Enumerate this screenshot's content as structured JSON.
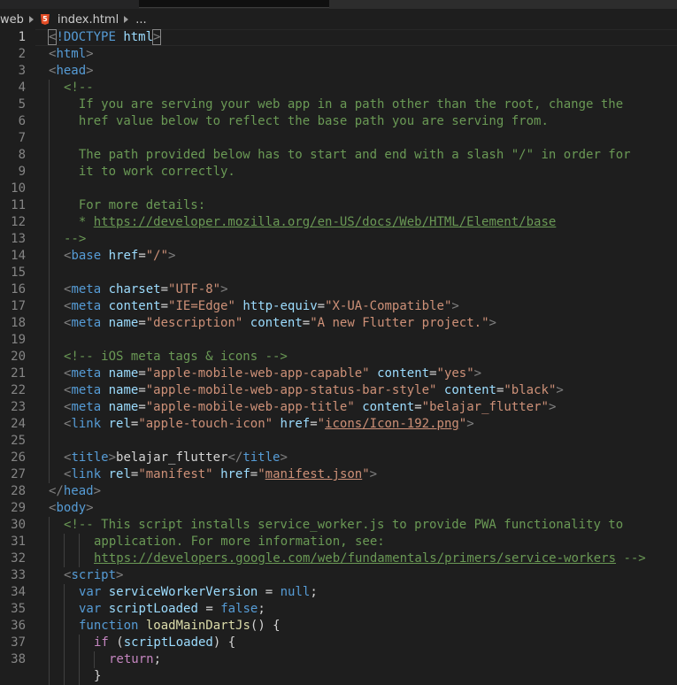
{
  "breadcrumb": {
    "folder": "web",
    "file": "index.html",
    "more": "..."
  },
  "editor": {
    "language": "html",
    "active_line": 1,
    "lines": [
      {
        "n": "1",
        "indent": 0,
        "tokens": [
          {
            "t": "<",
            "c": "punc"
          },
          {
            "t": "!DOCTYPE",
            "c": "tag"
          },
          {
            "t": " ",
            "c": "txt"
          },
          {
            "t": "html",
            "c": "attr"
          },
          {
            "t": ">",
            "c": "punc"
          }
        ]
      },
      {
        "n": "2",
        "indent": 0,
        "tokens": [
          {
            "t": "<",
            "c": "punc"
          },
          {
            "t": "html",
            "c": "tag"
          },
          {
            "t": ">",
            "c": "punc"
          }
        ]
      },
      {
        "n": "3",
        "indent": 0,
        "tokens": [
          {
            "t": "<",
            "c": "punc"
          },
          {
            "t": "head",
            "c": "tag"
          },
          {
            "t": ">",
            "c": "punc"
          }
        ]
      },
      {
        "n": "4",
        "indent": 1,
        "tokens": [
          {
            "t": "<!--",
            "c": "com"
          }
        ]
      },
      {
        "n": "5",
        "indent": 1,
        "tokens": [
          {
            "t": "  If you are serving your web app in a path other than the root, change the",
            "c": "com"
          }
        ]
      },
      {
        "n": "6",
        "indent": 1,
        "tokens": [
          {
            "t": "  href value below to reflect the base path you are serving from.",
            "c": "com"
          }
        ]
      },
      {
        "n": "7",
        "indent": 1,
        "tokens": []
      },
      {
        "n": "8",
        "indent": 1,
        "tokens": [
          {
            "t": "  The path provided below has to start and end with a slash \"/\" in order for",
            "c": "com"
          }
        ]
      },
      {
        "n": "9",
        "indent": 1,
        "tokens": [
          {
            "t": "  it to work correctly.",
            "c": "com"
          }
        ]
      },
      {
        "n": "10",
        "indent": 1,
        "tokens": []
      },
      {
        "n": "11",
        "indent": 1,
        "tokens": [
          {
            "t": "  For more details:",
            "c": "com"
          }
        ]
      },
      {
        "n": "12",
        "indent": 1,
        "tokens": [
          {
            "t": "  * ",
            "c": "com"
          },
          {
            "t": "https://developer.mozilla.org/en-US/docs/Web/HTML/Element/base",
            "c": "com link"
          }
        ]
      },
      {
        "n": "13",
        "indent": 1,
        "tokens": [
          {
            "t": "-->",
            "c": "com"
          }
        ]
      },
      {
        "n": "14",
        "indent": 1,
        "tokens": [
          {
            "t": "<",
            "c": "punc"
          },
          {
            "t": "base",
            "c": "tag"
          },
          {
            "t": " ",
            "c": "txt"
          },
          {
            "t": "href",
            "c": "attr"
          },
          {
            "t": "=",
            "c": "txt"
          },
          {
            "t": "\"/\"",
            "c": "str"
          },
          {
            "t": ">",
            "c": "punc"
          }
        ]
      },
      {
        "n": "15",
        "indent": 1,
        "tokens": []
      },
      {
        "n": "16",
        "indent": 1,
        "tokens": [
          {
            "t": "<",
            "c": "punc"
          },
          {
            "t": "meta",
            "c": "tag"
          },
          {
            "t": " ",
            "c": "txt"
          },
          {
            "t": "charset",
            "c": "attr"
          },
          {
            "t": "=",
            "c": "txt"
          },
          {
            "t": "\"UTF-8\"",
            "c": "str"
          },
          {
            "t": ">",
            "c": "punc"
          }
        ]
      },
      {
        "n": "17",
        "indent": 1,
        "tokens": [
          {
            "t": "<",
            "c": "punc"
          },
          {
            "t": "meta",
            "c": "tag"
          },
          {
            "t": " ",
            "c": "txt"
          },
          {
            "t": "content",
            "c": "attr"
          },
          {
            "t": "=",
            "c": "txt"
          },
          {
            "t": "\"IE=Edge\"",
            "c": "str"
          },
          {
            "t": " ",
            "c": "txt"
          },
          {
            "t": "http-equiv",
            "c": "attr"
          },
          {
            "t": "=",
            "c": "txt"
          },
          {
            "t": "\"X-UA-Compatible\"",
            "c": "str"
          },
          {
            "t": ">",
            "c": "punc"
          }
        ]
      },
      {
        "n": "18",
        "indent": 1,
        "tokens": [
          {
            "t": "<",
            "c": "punc"
          },
          {
            "t": "meta",
            "c": "tag"
          },
          {
            "t": " ",
            "c": "txt"
          },
          {
            "t": "name",
            "c": "attr"
          },
          {
            "t": "=",
            "c": "txt"
          },
          {
            "t": "\"description\"",
            "c": "str"
          },
          {
            "t": " ",
            "c": "txt"
          },
          {
            "t": "content",
            "c": "attr"
          },
          {
            "t": "=",
            "c": "txt"
          },
          {
            "t": "\"A new Flutter project.\"",
            "c": "str"
          },
          {
            "t": ">",
            "c": "punc"
          }
        ]
      },
      {
        "n": "19",
        "indent": 1,
        "tokens": []
      },
      {
        "n": "20",
        "indent": 1,
        "tokens": [
          {
            "t": "<!-- iOS meta tags & icons -->",
            "c": "com"
          }
        ]
      },
      {
        "n": "21",
        "indent": 1,
        "tokens": [
          {
            "t": "<",
            "c": "punc"
          },
          {
            "t": "meta",
            "c": "tag"
          },
          {
            "t": " ",
            "c": "txt"
          },
          {
            "t": "name",
            "c": "attr"
          },
          {
            "t": "=",
            "c": "txt"
          },
          {
            "t": "\"apple-mobile-web-app-capable\"",
            "c": "str"
          },
          {
            "t": " ",
            "c": "txt"
          },
          {
            "t": "content",
            "c": "attr"
          },
          {
            "t": "=",
            "c": "txt"
          },
          {
            "t": "\"yes\"",
            "c": "str"
          },
          {
            "t": ">",
            "c": "punc"
          }
        ]
      },
      {
        "n": "22",
        "indent": 1,
        "tokens": [
          {
            "t": "<",
            "c": "punc"
          },
          {
            "t": "meta",
            "c": "tag"
          },
          {
            "t": " ",
            "c": "txt"
          },
          {
            "t": "name",
            "c": "attr"
          },
          {
            "t": "=",
            "c": "txt"
          },
          {
            "t": "\"apple-mobile-web-app-status-bar-style\"",
            "c": "str"
          },
          {
            "t": " ",
            "c": "txt"
          },
          {
            "t": "content",
            "c": "attr"
          },
          {
            "t": "=",
            "c": "txt"
          },
          {
            "t": "\"black\"",
            "c": "str"
          },
          {
            "t": ">",
            "c": "punc"
          }
        ]
      },
      {
        "n": "23",
        "indent": 1,
        "tokens": [
          {
            "t": "<",
            "c": "punc"
          },
          {
            "t": "meta",
            "c": "tag"
          },
          {
            "t": " ",
            "c": "txt"
          },
          {
            "t": "name",
            "c": "attr"
          },
          {
            "t": "=",
            "c": "txt"
          },
          {
            "t": "\"apple-mobile-web-app-title\"",
            "c": "str"
          },
          {
            "t": " ",
            "c": "txt"
          },
          {
            "t": "content",
            "c": "attr"
          },
          {
            "t": "=",
            "c": "txt"
          },
          {
            "t": "\"belajar_flutter\"",
            "c": "str"
          },
          {
            "t": ">",
            "c": "punc"
          }
        ]
      },
      {
        "n": "24",
        "indent": 1,
        "tokens": [
          {
            "t": "<",
            "c": "punc"
          },
          {
            "t": "link",
            "c": "tag"
          },
          {
            "t": " ",
            "c": "txt"
          },
          {
            "t": "rel",
            "c": "attr"
          },
          {
            "t": "=",
            "c": "txt"
          },
          {
            "t": "\"apple-touch-icon\"",
            "c": "str"
          },
          {
            "t": " ",
            "c": "txt"
          },
          {
            "t": "href",
            "c": "attr"
          },
          {
            "t": "=",
            "c": "txt"
          },
          {
            "t": "\"",
            "c": "str"
          },
          {
            "t": "icons/Icon-192.png",
            "c": "str link"
          },
          {
            "t": "\"",
            "c": "str"
          },
          {
            "t": ">",
            "c": "punc"
          }
        ]
      },
      {
        "n": "25",
        "indent": 1,
        "tokens": []
      },
      {
        "n": "26",
        "indent": 1,
        "tokens": [
          {
            "t": "<",
            "c": "punc"
          },
          {
            "t": "title",
            "c": "tag"
          },
          {
            "t": ">",
            "c": "punc"
          },
          {
            "t": "belajar_flutter",
            "c": "txt"
          },
          {
            "t": "</",
            "c": "punc"
          },
          {
            "t": "title",
            "c": "tag"
          },
          {
            "t": ">",
            "c": "punc"
          }
        ]
      },
      {
        "n": "27",
        "indent": 1,
        "tokens": [
          {
            "t": "<",
            "c": "punc"
          },
          {
            "t": "link",
            "c": "tag"
          },
          {
            "t": " ",
            "c": "txt"
          },
          {
            "t": "rel",
            "c": "attr"
          },
          {
            "t": "=",
            "c": "txt"
          },
          {
            "t": "\"manifest\"",
            "c": "str"
          },
          {
            "t": " ",
            "c": "txt"
          },
          {
            "t": "href",
            "c": "attr"
          },
          {
            "t": "=",
            "c": "txt"
          },
          {
            "t": "\"",
            "c": "str"
          },
          {
            "t": "manifest.json",
            "c": "str link"
          },
          {
            "t": "\"",
            "c": "str"
          },
          {
            "t": ">",
            "c": "punc"
          }
        ]
      },
      {
        "n": "28",
        "indent": 0,
        "tokens": [
          {
            "t": "</",
            "c": "punc"
          },
          {
            "t": "head",
            "c": "tag"
          },
          {
            "t": ">",
            "c": "punc"
          }
        ]
      },
      {
        "n": "29",
        "indent": 0,
        "tokens": [
          {
            "t": "<",
            "c": "punc"
          },
          {
            "t": "body",
            "c": "tag"
          },
          {
            "t": ">",
            "c": "punc"
          }
        ]
      },
      {
        "n": "30",
        "indent": 1,
        "tokens": [
          {
            "t": "<!-- This script installs service_worker.js to provide PWA functionality to",
            "c": "com"
          }
        ]
      },
      {
        "n": "31",
        "indent": 3,
        "tokens": [
          {
            "t": "application. For more information, see:",
            "c": "com"
          }
        ]
      },
      {
        "n": "32",
        "indent": 3,
        "tokens": [
          {
            "t": "https://developers.google.com/web/fundamentals/primers/service-workers",
            "c": "com link"
          },
          {
            "t": " -->",
            "c": "com"
          }
        ]
      },
      {
        "n": "33",
        "indent": 1,
        "tokens": [
          {
            "t": "<",
            "c": "punc"
          },
          {
            "t": "script",
            "c": "tag"
          },
          {
            "t": ">",
            "c": "punc"
          }
        ]
      },
      {
        "n": "34",
        "indent": 2,
        "tokens": [
          {
            "t": "var",
            "c": "kw"
          },
          {
            "t": " ",
            "c": "txt"
          },
          {
            "t": "serviceWorkerVersion",
            "c": "var"
          },
          {
            "t": " = ",
            "c": "txt"
          },
          {
            "t": "null",
            "c": "kw"
          },
          {
            "t": ";",
            "c": "txt"
          }
        ]
      },
      {
        "n": "35",
        "indent": 2,
        "tokens": [
          {
            "t": "var",
            "c": "kw"
          },
          {
            "t": " ",
            "c": "txt"
          },
          {
            "t": "scriptLoaded",
            "c": "var"
          },
          {
            "t": " = ",
            "c": "txt"
          },
          {
            "t": "false",
            "c": "kw"
          },
          {
            "t": ";",
            "c": "txt"
          }
        ]
      },
      {
        "n": "36",
        "indent": 2,
        "tokens": [
          {
            "t": "function",
            "c": "kw"
          },
          {
            "t": " ",
            "c": "txt"
          },
          {
            "t": "loadMainDartJs",
            "c": "fn"
          },
          {
            "t": "() {",
            "c": "txt"
          }
        ]
      },
      {
        "n": "37",
        "indent": 3,
        "tokens": [
          {
            "t": "if",
            "c": "ctl"
          },
          {
            "t": " (",
            "c": "txt"
          },
          {
            "t": "scriptLoaded",
            "c": "var"
          },
          {
            "t": ") {",
            "c": "txt"
          }
        ]
      },
      {
        "n": "38",
        "indent": 4,
        "tokens": [
          {
            "t": "return",
            "c": "ctl"
          },
          {
            "t": ";",
            "c": "txt"
          }
        ]
      },
      {
        "n": "",
        "indent": 3,
        "tokens": [
          {
            "t": "}",
            "c": "txt"
          }
        ]
      }
    ]
  }
}
